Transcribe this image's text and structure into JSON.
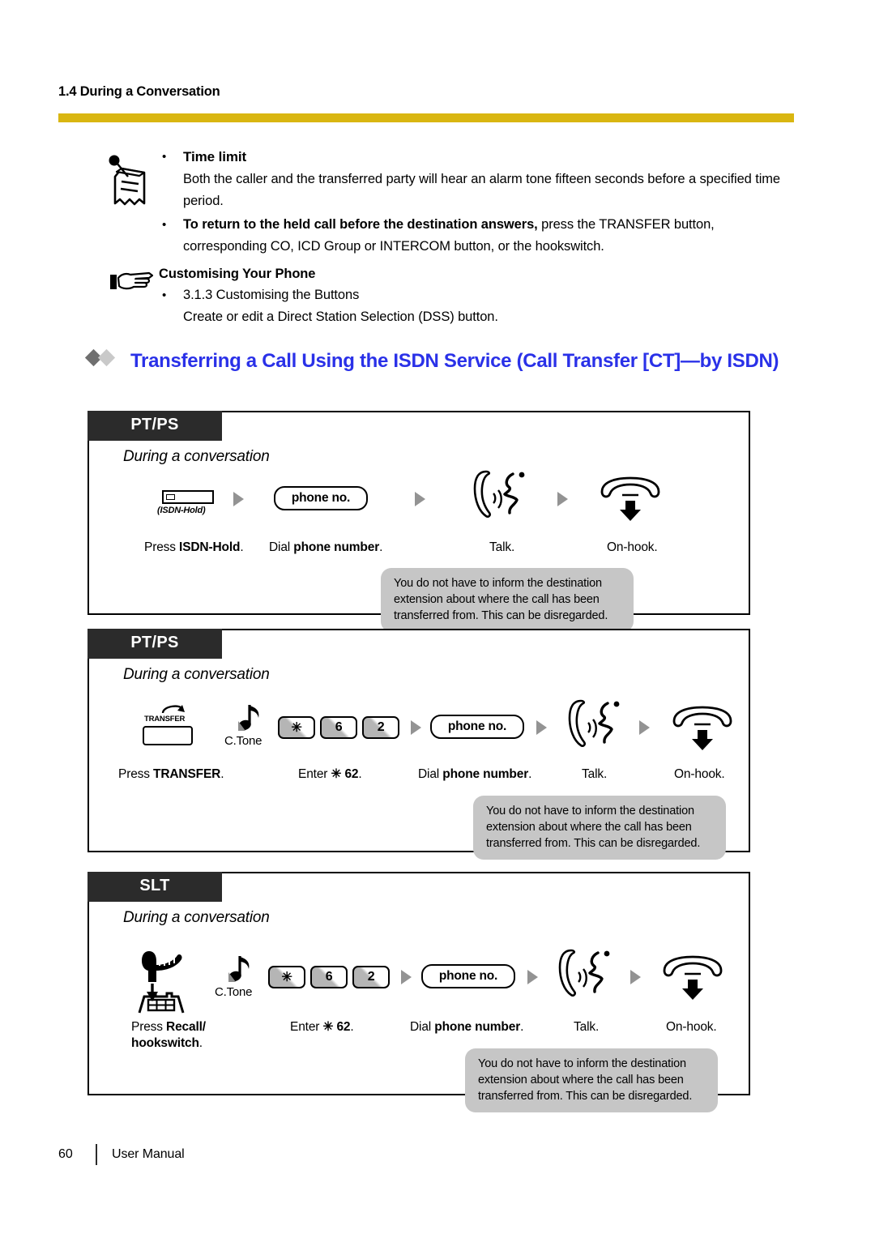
{
  "header": {
    "section_title": "1.4 During a Conversation",
    "rule_color": "#d9b611"
  },
  "note": {
    "icon": "pinned-note-icon",
    "items": [
      {
        "bullet": "•",
        "title": "Time limit",
        "body": "Both the caller and the transferred party will hear an alarm tone fifteen seconds before a specified time period."
      },
      {
        "bullet": "•",
        "bold_lead": "To return to the held call before the destination answers,",
        "body": " press the TRANSFER button, corresponding CO, ICD Group or INTERCOM button, or the hookswitch."
      }
    ]
  },
  "customising": {
    "icon": "pointing-hand-icon",
    "title": "Customising Your Phone",
    "bullet": "•",
    "item": "3.1.3 Customising the Buttons",
    "item_desc": "Create or edit a Direct Station Selection (DSS) button."
  },
  "heading": {
    "text": "Transferring a Call Using the ISDN Service (Call Transfer [CT]—by ISDN)",
    "color": "#2a31e8",
    "diamond_dark": "#6f6f6f",
    "diamond_light": "#c9c9c9"
  },
  "bubble_text_lines": [
    "You do not have to inform the destination",
    "extension about where the call has been",
    "transferred from. This can be disregarded."
  ],
  "boxes": [
    {
      "tab": "PT/PS",
      "subtitle": "During a conversation",
      "steps": [
        {
          "icon": "isdn-hold-key-icon",
          "icon_caption": "(ISDN-Hold)",
          "label_plain": "Press ",
          "label_bold": "ISDN-Hold",
          "label_tail": "."
        },
        {
          "icon": "phone-no-pill",
          "pill_text": "phone no.",
          "label_plain": "Dial ",
          "label_bold": "phone number",
          "label_tail": "."
        },
        {
          "icon": "talk-handset-icon",
          "label_plain": "Talk.",
          "label_bold": "",
          "label_tail": ""
        },
        {
          "icon": "on-hook-icon",
          "label_plain": "On-hook.",
          "label_bold": "",
          "label_tail": ""
        }
      ]
    },
    {
      "tab": "PT/PS",
      "subtitle": "During a conversation",
      "steps": [
        {
          "icon": "transfer-key-icon",
          "icon_caption": "TRANSFER",
          "label_plain": "Press ",
          "label_bold": "TRANSFER",
          "label_tail": "."
        },
        {
          "icon": "confirmation-tone-icon",
          "icon_caption": "C.Tone",
          "keys": [
            "✳",
            "6",
            "2"
          ],
          "label_plain": "Enter ",
          "label_bold": "✳ 62",
          "label_tail": "."
        },
        {
          "icon": "phone-no-pill",
          "pill_text": "phone no.",
          "label_plain": "Dial ",
          "label_bold": "phone number",
          "label_tail": "."
        },
        {
          "icon": "talk-handset-icon",
          "label_plain": "Talk.",
          "label_bold": "",
          "label_tail": ""
        },
        {
          "icon": "on-hook-icon",
          "label_plain": "On-hook.",
          "label_bold": "",
          "label_tail": ""
        }
      ]
    },
    {
      "tab": "SLT",
      "subtitle": "During a conversation",
      "steps": [
        {
          "icon": "recall-hookswitch-icon",
          "label_plain": "Press ",
          "label_bold": "Recall/",
          "label_bold2": "hookswitch",
          "label_tail": "."
        },
        {
          "icon": "confirmation-tone-icon",
          "icon_caption": "C.Tone",
          "keys": [
            "✳",
            "6",
            "2"
          ],
          "label_plain": "Enter ",
          "label_bold": "✳ 62",
          "label_tail": "."
        },
        {
          "icon": "phone-no-pill",
          "pill_text": "phone no.",
          "label_plain": "Dial ",
          "label_bold": "phone number",
          "label_tail": "."
        },
        {
          "icon": "talk-handset-icon",
          "label_plain": "Talk.",
          "label_bold": "",
          "label_tail": ""
        },
        {
          "icon": "on-hook-icon",
          "label_plain": "On-hook.",
          "label_bold": "",
          "label_tail": ""
        }
      ]
    }
  ],
  "footer": {
    "page_number": "60",
    "label": "User Manual"
  }
}
